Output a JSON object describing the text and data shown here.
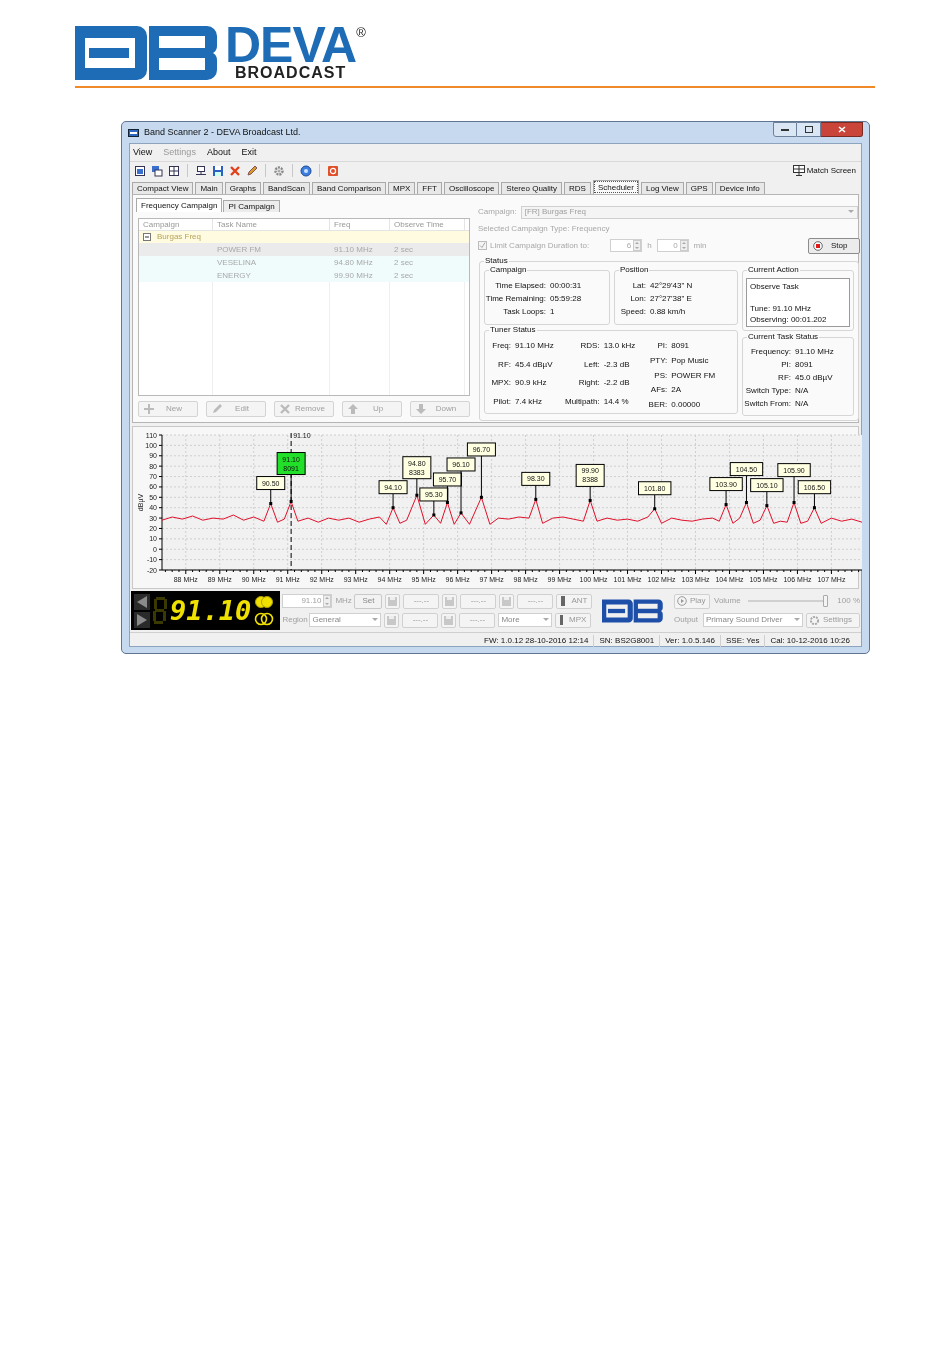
{
  "document_header": {
    "brand": "DEVA",
    "registered_mark": "®",
    "tagline": "BROADCAST"
  },
  "window": {
    "title": "Band Scanner 2 - DEVA Broadcast Ltd."
  },
  "menu": [
    {
      "label": "View",
      "disabled": false
    },
    {
      "label": "Settings",
      "disabled": true
    },
    {
      "label": "About",
      "disabled": false
    },
    {
      "label": "Exit",
      "disabled": false
    }
  ],
  "toolbar": {
    "match_screen": "Match Screen"
  },
  "tabs": [
    {
      "label": "Compact View",
      "selected": false
    },
    {
      "label": "Main",
      "selected": false
    },
    {
      "label": "Graphs",
      "selected": false
    },
    {
      "label": "BandScan",
      "selected": false
    },
    {
      "label": "Band Comparison",
      "selected": false
    },
    {
      "label": "MPX",
      "selected": false
    },
    {
      "label": "FFT",
      "selected": false
    },
    {
      "label": "Oscilloscope",
      "selected": false
    },
    {
      "label": "Stereo Quality",
      "selected": false
    },
    {
      "label": "RDS",
      "selected": false
    },
    {
      "label": "Scheduler",
      "selected": true
    },
    {
      "label": "Log View",
      "selected": false
    },
    {
      "label": "GPS",
      "selected": false
    },
    {
      "label": "Device Info",
      "selected": false
    }
  ],
  "subtabs": [
    {
      "label": "Frequency Campaign",
      "selected": true
    },
    {
      "label": "PI Campaign",
      "selected": false
    }
  ],
  "task_table": {
    "columns": [
      "Campaign",
      "Task Name",
      "Freq",
      "Observe Time"
    ],
    "groups": [
      {
        "campaign": "Burgas Freq",
        "expanded": true,
        "rows": [
          {
            "task_name": "POWER FM",
            "freq": "91.10 MHz",
            "observe_time": "2 sec",
            "selected": true
          },
          {
            "task_name": "VESELINA",
            "freq": "94.80 MHz",
            "observe_time": "2 sec",
            "selected": false
          },
          {
            "task_name": "ENERGY",
            "freq": "99.90 MHz",
            "observe_time": "2 sec",
            "selected": false
          }
        ]
      }
    ]
  },
  "task_buttons": [
    {
      "kind": "new",
      "label": "New",
      "disabled": true
    },
    {
      "kind": "edit",
      "label": "Edit",
      "disabled": true
    },
    {
      "kind": "remove",
      "label": "Remove",
      "disabled": true
    },
    {
      "kind": "up",
      "label": "Up",
      "disabled": true
    },
    {
      "kind": "down",
      "label": "Down",
      "disabled": true
    }
  ],
  "campaign": {
    "label": "Campaign:",
    "value": "[FR] Burgas Freq",
    "disabled": true
  },
  "campaign_type": {
    "label": "Selected Campaign Type:",
    "value": "Frequency"
  },
  "duration_limit": {
    "label": "Limit Campaign Duration to:",
    "checked": true,
    "disabled": true,
    "hours": "6",
    "hours_unit": "h",
    "minutes": "0",
    "minutes_unit": "min"
  },
  "stop_button": "Stop",
  "status": {
    "title": "Status",
    "campaign": {
      "title": "Campaign",
      "fields": [
        {
          "label": "Time Elapsed:",
          "value": "00:00:31"
        },
        {
          "label": "Time Remaining:",
          "value": "05:59:28"
        },
        {
          "label": "Task Loops:",
          "value": "1"
        }
      ]
    },
    "position": {
      "title": "Position",
      "fields": [
        {
          "label": "Lat:",
          "value": "42°29'43\" N"
        },
        {
          "label": "Lon:",
          "value": "27°27'38\" E"
        },
        {
          "label": "Speed:",
          "value": "0.88 km/h"
        }
      ]
    },
    "current_action": {
      "title": "Current Action",
      "lines": [
        "Observe Task",
        "Tune: 91.10 MHz",
        "Observing: 00:01.202"
      ]
    },
    "tuner_status": {
      "title": "Tuner Status",
      "columns": [
        [
          {
            "label": "Freq:",
            "value": "91.10 MHz"
          },
          {
            "label": "RF:",
            "value": "45.4 dBµV"
          },
          {
            "label": "MPX:",
            "value": "90.9 kHz"
          },
          {
            "label": "Pilot:",
            "value": "7.4 kHz"
          }
        ],
        [
          {
            "label": "RDS:",
            "value": "13.0 kHz"
          },
          {
            "label": "Left:",
            "value": "-2.3 dB"
          },
          {
            "label": "Right:",
            "value": "-2.2 dB"
          },
          {
            "label": "Multipath:",
            "value": "14.4 %"
          }
        ],
        [
          {
            "label": "PI:",
            "value": "8091"
          },
          {
            "label": "PTY:",
            "value": "Pop Music"
          },
          {
            "label": "PS:",
            "value": "POWER FM"
          },
          {
            "label": "AFs:",
            "value": "2A"
          },
          {
            "label": "BER:",
            "value": "0.00000"
          }
        ]
      ]
    },
    "current_task_status": {
      "title": "Current Task Status",
      "fields": [
        {
          "label": "Frequency:",
          "value": "91.10 MHz"
        },
        {
          "label": "PI:",
          "value": "8091"
        },
        {
          "label": "RF:",
          "value": "45.0 dBµV"
        },
        {
          "label": "Switch Type:",
          "value": "N/A"
        },
        {
          "label": "Switch From:",
          "value": "N/A"
        }
      ]
    }
  },
  "spectrum": {
    "chart_data": {
      "type": "line",
      "ylabel": "dBµV",
      "xlim": [
        87.3,
        107.9
      ],
      "ylim": [
        -20,
        110
      ],
      "yticks": [
        -20,
        -10,
        0,
        10,
        20,
        30,
        40,
        50,
        60,
        70,
        80,
        90,
        100,
        110
      ],
      "xticks": [
        {
          "value": 88,
          "label": "88 MHz"
        },
        {
          "value": 89,
          "label": "89 MHz"
        },
        {
          "value": 90,
          "label": "90 MHz"
        },
        {
          "value": 91,
          "label": "91 MHz"
        },
        {
          "value": 92,
          "label": "92 MHz"
        },
        {
          "value": 93,
          "label": "93 MHz"
        },
        {
          "value": 94,
          "label": "94 MHz"
        },
        {
          "value": 95,
          "label": "95 MHz"
        },
        {
          "value": 96,
          "label": "96 MHz"
        },
        {
          "value": 97,
          "label": "97 MHz"
        },
        {
          "value": 98,
          "label": "98 MHz"
        },
        {
          "value": 99,
          "label": "99 MHz"
        },
        {
          "value": 100,
          "label": "100 MHz"
        },
        {
          "value": 101,
          "label": "101 MHz"
        },
        {
          "value": 102,
          "label": "102 MHz"
        },
        {
          "value": 103,
          "label": "103 MHz"
        },
        {
          "value": 104,
          "label": "104 MHz"
        },
        {
          "value": 105,
          "label": "105 MHz"
        },
        {
          "value": 106,
          "label": "106 MHz"
        },
        {
          "value": 107,
          "label": "107 MHz"
        }
      ],
      "x": [
        87.3,
        87.6,
        87.9,
        88.2,
        88.5,
        88.8,
        89.1,
        89.4,
        89.7,
        90.0,
        90.3,
        90.5,
        90.7,
        90.9,
        91.1,
        91.3,
        91.6,
        91.9,
        92.2,
        92.5,
        92.8,
        93.1,
        93.4,
        93.7,
        93.9,
        94.1,
        94.3,
        94.5,
        94.8,
        95.05,
        95.3,
        95.5,
        95.7,
        95.9,
        96.1,
        96.35,
        96.7,
        96.95,
        97.2,
        97.5,
        97.8,
        98.1,
        98.3,
        98.5,
        98.8,
        99.1,
        99.4,
        99.7,
        99.9,
        100.1,
        100.4,
        100.7,
        101.0,
        101.3,
        101.6,
        101.8,
        102.0,
        102.3,
        102.6,
        102.9,
        103.2,
        103.5,
        103.7,
        103.9,
        104.1,
        104.3,
        104.5,
        104.7,
        104.9,
        105.1,
        105.3,
        105.5,
        105.7,
        105.9,
        106.1,
        106.3,
        106.5,
        106.7,
        107.0,
        107.3,
        107.6,
        107.9
      ],
      "grid": true,
      "ref_lines": [
        {
          "axis": "x",
          "value": 91.1,
          "label": "91.10"
        }
      ],
      "series": [
        {
          "color": "#e0102a",
          "values": [
            28,
            31,
            29,
            32,
            28,
            30,
            29,
            33,
            28,
            31,
            27,
            44,
            26,
            29,
            46,
            27,
            30,
            26,
            30,
            28,
            30,
            26,
            29,
            31,
            24,
            40,
            25,
            28,
            52,
            24,
            33,
            25,
            45,
            24,
            35,
            24,
            50,
            24,
            30,
            29,
            31,
            30,
            48,
            25,
            30,
            31,
            29,
            27,
            47,
            27,
            30,
            28,
            29,
            27,
            31,
            39,
            25,
            30,
            28,
            27,
            29,
            30,
            27,
            43,
            25,
            30,
            45,
            25,
            28,
            42,
            25,
            27,
            26,
            45,
            25,
            27,
            40,
            25,
            30,
            27,
            29,
            26
          ]
        }
      ],
      "annotations": [
        {
          "x": 90.5,
          "y": 44,
          "text": "90.50"
        },
        {
          "x": 91.1,
          "y": 46,
          "text": "91.10\n8091"
        },
        {
          "x": 94.1,
          "y": 40,
          "text": "94.10"
        },
        {
          "x": 94.8,
          "y": 52,
          "text": "94.80\n8383"
        },
        {
          "x": 95.3,
          "y": 33,
          "text": "95.30"
        },
        {
          "x": 95.7,
          "y": 45,
          "text": "95.70"
        },
        {
          "x": 96.1,
          "y": 35,
          "text": "96.10"
        },
        {
          "x": 96.7,
          "y": 50,
          "text": "96.70"
        },
        {
          "x": 98.3,
          "y": 48,
          "text": "98.30"
        },
        {
          "x": 99.9,
          "y": 47,
          "text": "99.90\n8388"
        },
        {
          "x": 101.8,
          "y": 39,
          "text": "101.80"
        },
        {
          "x": 103.9,
          "y": 43,
          "text": "103.90"
        },
        {
          "x": 104.5,
          "y": 45,
          "text": "104.50"
        },
        {
          "x": 105.1,
          "y": 42,
          "text": "105.10"
        },
        {
          "x": 105.9,
          "y": 45,
          "text": "105.90"
        },
        {
          "x": 106.5,
          "y": 40,
          "text": "106.50"
        }
      ]
    },
    "station_labels": [
      {
        "selected": false
      },
      {
        "selected": true
      },
      {
        "selected": false
      },
      {
        "selected": false
      },
      {
        "selected": false
      },
      {
        "selected": false
      },
      {
        "selected": false
      },
      {
        "selected": false
      },
      {
        "selected": false
      },
      {
        "selected": false
      },
      {
        "selected": false
      },
      {
        "selected": false
      },
      {
        "selected": false
      },
      {
        "selected": false
      },
      {
        "selected": false
      },
      {
        "selected": false
      }
    ]
  },
  "tuner_display": {
    "frequency": "91.10"
  },
  "tuning": {
    "frequency": "91.10",
    "unit": "MHz",
    "set_button": "Set",
    "region_label": "Region",
    "region": "General"
  },
  "memory_slots": [
    [
      "---.--",
      "---.--",
      "---.--"
    ],
    [
      "---.--",
      "---.--"
    ]
  ],
  "more_select": "More",
  "inputs": [
    {
      "label": "ANT"
    },
    {
      "label": "MPX"
    }
  ],
  "audio": {
    "play": "Play",
    "volume_label": "Volume",
    "level": 0.97,
    "reading": "100 %",
    "output_label": "Output",
    "output": "Primary Sound Driver",
    "settings": "Settings"
  },
  "status_bar": [
    "FW: 1.0.12 28-10-2016 12:14",
    "SN: BS2G8001",
    "Ver: 1.0.5.146",
    "SSE: Yes",
    "Cal: 10-12-2016 10:26"
  ]
}
